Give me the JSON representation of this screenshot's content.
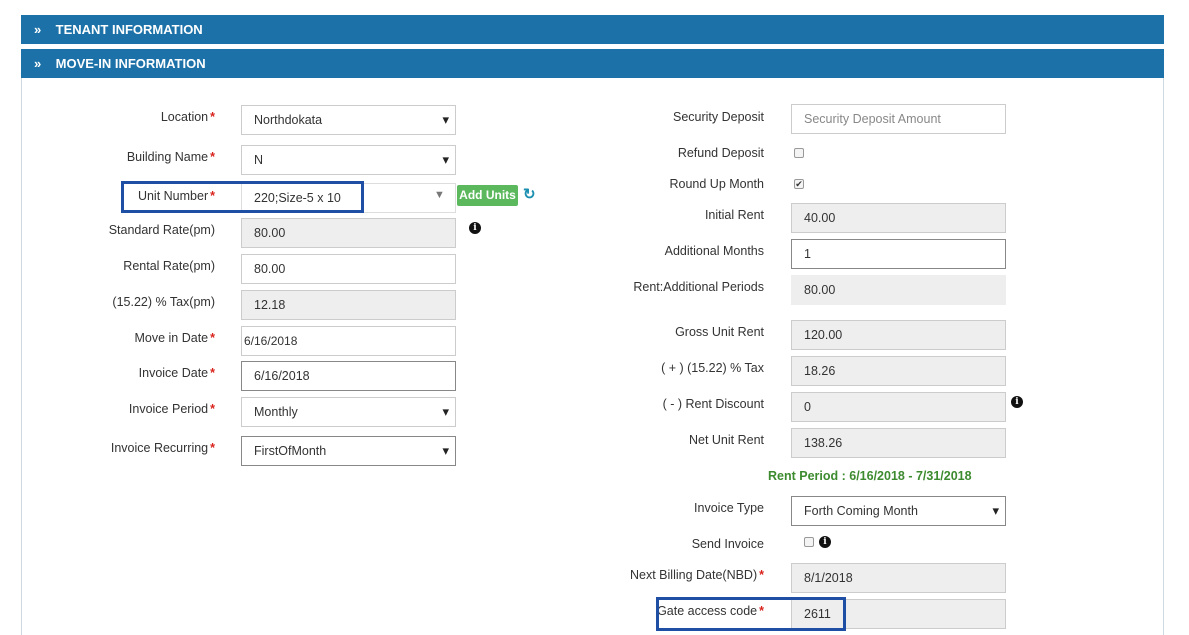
{
  "panels": {
    "tenant": {
      "title": "TENANT INFORMATION",
      "icon": "double-chevron-right-icon"
    },
    "movein": {
      "title": "MOVE-IN INFORMATION",
      "icon": "double-chevron-down-icon"
    }
  },
  "required_mark": "*",
  "left": {
    "location": {
      "label": "Location",
      "value": "Northdokata"
    },
    "building": {
      "label": "Building Name",
      "value": "N"
    },
    "unit": {
      "label": "Unit Number",
      "value": "220;Size-5  x  10",
      "add_button": "Add Units"
    },
    "standard_rate": {
      "label": "Standard Rate(pm)",
      "value": "80.00"
    },
    "rental_rate": {
      "label": "Rental Rate(pm)",
      "value": "80.00"
    },
    "tax": {
      "label": "(15.22) % Tax(pm)",
      "value": "12.18"
    },
    "move_in_date": {
      "label": "Move in Date",
      "value": "6/16/2018"
    },
    "invoice_date": {
      "label": "Invoice Date",
      "value": "6/16/2018"
    },
    "invoice_period": {
      "label": "Invoice Period",
      "value": "Monthly"
    },
    "invoice_recurring": {
      "label": "Invoice Recurring",
      "value": "FirstOfMonth"
    }
  },
  "right": {
    "security_deposit": {
      "label": "Security Deposit",
      "placeholder": "Security Deposit Amount"
    },
    "refund_deposit": {
      "label": "Refund Deposit",
      "checked": false
    },
    "round_up_month": {
      "label": "Round Up Month",
      "checked": true
    },
    "initial_rent": {
      "label": "Initial Rent",
      "value": "40.00"
    },
    "additional_months": {
      "label": "Additional Months",
      "value": "1"
    },
    "rent_additional_periods": {
      "label": "Rent:Additional Periods",
      "value": "80.00"
    },
    "gross_unit_rent": {
      "label": "Gross Unit Rent",
      "value": "120.00"
    },
    "plus_tax": {
      "label": "( + ) (15.22) % Tax",
      "value": "18.26"
    },
    "rent_discount": {
      "label": "( - ) Rent Discount",
      "value": "0"
    },
    "net_unit_rent": {
      "label": "Net Unit Rent",
      "value": "138.26"
    },
    "rent_period": "Rent Period : 6/16/2018 - 7/31/2018",
    "invoice_type": {
      "label": "Invoice Type",
      "value": "Forth Coming Month"
    },
    "send_invoice": {
      "label": "Send Invoice",
      "checked": false
    },
    "next_billing": {
      "label": "Next Billing Date(NBD)",
      "value": "8/1/2018"
    },
    "gate_code": {
      "label": "Gate access code",
      "value": "2611"
    }
  },
  "colors": {
    "header": "#1c72a8",
    "highlight": "#1f4fa5",
    "green": "#5cb85c",
    "required": "#d9231c"
  }
}
